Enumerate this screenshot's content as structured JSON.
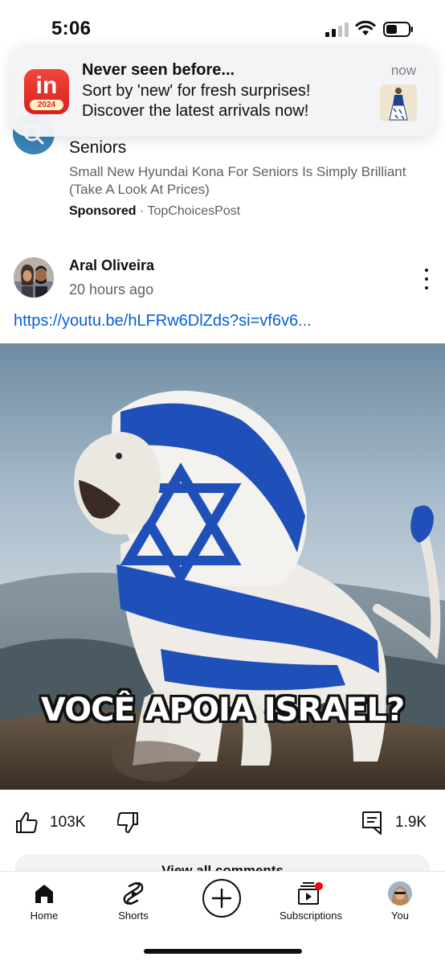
{
  "status_bar": {
    "time": "5:06"
  },
  "notification": {
    "app_icon_text": "in",
    "app_icon_year": "2024",
    "title": "Never seen before...",
    "line1": "Sort by 'new' for fresh surprises!",
    "line2": "Discover the latest arrivals now!",
    "time": "now"
  },
  "ad": {
    "title": "Seniors",
    "description": "Small New Hyundai Kona For Seniors Is Simply Brilliant (Take A Look At Prices)",
    "sponsored_label": "Sponsored",
    "separator": " · ",
    "source": "TopChoicesPost"
  },
  "post": {
    "author": "Aral Oliveira",
    "time": "20 hours ago",
    "link": "https://youtu.be/hLFRw6DlZds?si=vf6v6...",
    "image_caption": "VOCÊ APOIA ISRAEL?",
    "likes": "103K",
    "comments": "1.9K",
    "view_comments_label": "View all comments"
  },
  "bottom_nav": {
    "home": "Home",
    "shorts": "Shorts",
    "subscriptions": "Subscriptions",
    "you": "You"
  },
  "colors": {
    "link": "#065fd4",
    "secondary_text": "#606060",
    "notification_badge": "#ff0000",
    "flag_blue": "#1f4fb8"
  },
  "icons": [
    "signal-icon",
    "wifi-icon",
    "battery-icon",
    "search-icon",
    "more-vert-icon",
    "thumbs-up-icon",
    "thumbs-down-icon",
    "comment-icon",
    "home-icon",
    "shorts-icon",
    "create-plus-icon",
    "subscriptions-icon"
  ]
}
